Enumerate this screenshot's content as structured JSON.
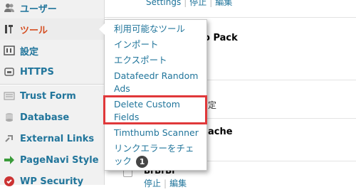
{
  "sidebar": {
    "items": [
      {
        "label": "ユーザー",
        "icon": "users-icon"
      },
      {
        "label": "ツール",
        "icon": "tools-icon"
      },
      {
        "label": "設定",
        "icon": "settings-icon"
      },
      {
        "label": "HTTPS",
        "icon": "lock-icon"
      },
      {
        "label": "Trust Form",
        "icon": "trust-form-icon"
      },
      {
        "label": "Database",
        "icon": "database-icon"
      },
      {
        "label": "External Links",
        "icon": "external-links-icon"
      },
      {
        "label": "PageNavi Style",
        "icon": "pagenavi-arrow-icon"
      },
      {
        "label": "WP Security",
        "icon": "shield-icon"
      }
    ]
  },
  "flyout": {
    "items": [
      "利用可能なツール",
      "インポート",
      "エクスポート",
      "Datafeedr Random Ads",
      "Delete Custom Fields",
      "Timthumb Scanner",
      "リンクエラーをチェック"
    ],
    "badge": "1"
  },
  "main": {
    "top_links": [
      "Settings",
      "停止",
      "編集"
    ],
    "row1_name_fragment": "o Pack",
    "row2_fragment": "定",
    "row3_name_fragment": "ache",
    "row4_name_fragment": "BrBrBr",
    "row4_links": [
      "停止",
      "編集"
    ]
  },
  "colors": {
    "link": "#21759b",
    "active_menu": "#d54e21",
    "highlight": "#e0383a"
  }
}
